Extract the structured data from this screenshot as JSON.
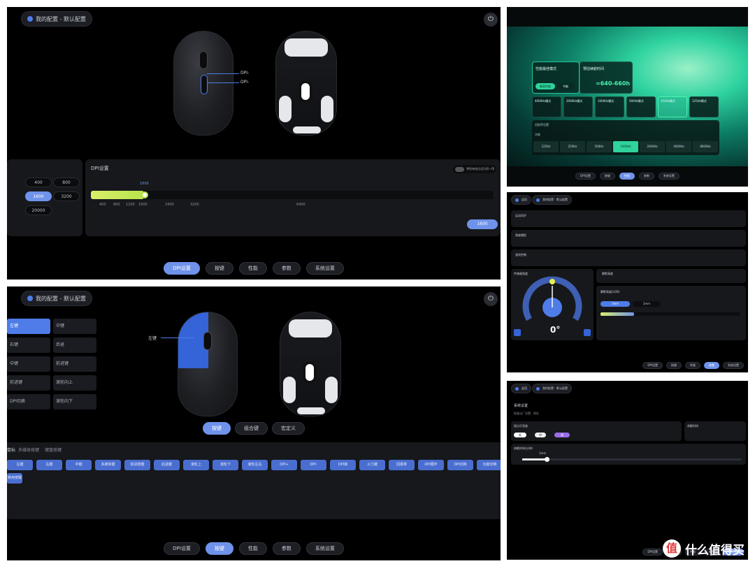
{
  "p1": {
    "config_label": "我的配置 - 默认配置",
    "callouts": [
      "DPI-",
      "DPI-"
    ],
    "dpi_panel_title": "DPI设置",
    "dpi_left_values": [
      "400",
      "800",
      "1600",
      "3200",
      "20000"
    ],
    "dpi_slider_value": "1600",
    "dpi_scale": [
      "400",
      "800",
      "1200",
      "1600",
      "2400",
      "3200",
      "6400"
    ],
    "toggle_label": "将所有档位设为同一DPI",
    "dpi_readout": "1600",
    "tabs": [
      "DPI设置",
      "按键",
      "性能",
      "参数",
      "系统设置"
    ],
    "active_tab": 0
  },
  "p2": {
    "config_label": "我的配置 - 默认配置",
    "callout": "左键",
    "side_buttons_left": [
      "左键",
      "右键",
      "中键",
      "前进键",
      "DPI切换"
    ],
    "side_buttons_right": [
      "中键",
      "后退",
      "前进键",
      "滚轮向上",
      "滚轮向下"
    ],
    "mode_buttons": [
      "按键",
      "组合键",
      "宏定义"
    ],
    "sub_tabs": [
      "鼠标",
      "多媒体按键",
      "键盘按键"
    ],
    "keys_row1": [
      "左键",
      "右键",
      "中键",
      "多媒体键",
      "前进按键",
      "后退键",
      "滚轮上",
      "滚轮下",
      "滚轮左右",
      "DPI+",
      "DPI-",
      "DPI锁",
      "火力键",
      "回报率",
      "DPI循环",
      "DPI切换",
      "功能切换"
    ],
    "keys_row2": [
      "禁用按键"
    ],
    "tabs": [
      "DPI设置",
      "按键",
      "性能",
      "参数",
      "系统设置"
    ],
    "active_tab": 1
  },
  "p3": {
    "card_title": "性能最佳模式",
    "card_btns": [
      "最高性能",
      "节能"
    ],
    "battery_title": "预估续航时间",
    "battery_value": "≈640-660h",
    "modes": [
      "4000Hz模式",
      "2000Hz模式",
      "1000Hz模式",
      "500Hz模式",
      "250Hz模式",
      "125Hz模式"
    ],
    "rate_label": "回报率设置",
    "rate_label2": "功耗",
    "rates": [
      "125Hz",
      "250Hz",
      "500Hz",
      "1000Hz",
      "2000Hz",
      "4000Hz",
      "8000Hz"
    ],
    "active_rate": 3,
    "tabs": [
      "DPI设置",
      "按键",
      "性能",
      "参数",
      "系统设置"
    ],
    "active_tab": 2
  },
  "p4": {
    "chips": [
      "返回",
      "我的配置 - 默认配置"
    ],
    "rows": [
      "运动同步",
      "角度捕捉",
      "波纹控制"
    ],
    "angle_title": "传感器角度",
    "angle_value": "0°",
    "ticks": [
      "-30°",
      "-20°",
      "-10°",
      "0°",
      "10°",
      "20°",
      "30°"
    ],
    "lod_title": "静默高度",
    "lod_label": "静默高度(LOD)",
    "lod_btns": [
      "1mm",
      "2mm"
    ],
    "tabs": [
      "DPI设置",
      "按键",
      "性能",
      "参数",
      "系统设置"
    ],
    "active_tab": 3
  },
  "p5": {
    "chips": [
      "返回",
      "我的配置 - 默认配置"
    ],
    "section": "系统设置",
    "sub": "恢复出厂设置 - 保存",
    "light_title": "指示灯亮度",
    "light_btns": [
      "低",
      "中",
      "高"
    ],
    "right_title": "休眠时间",
    "sleep_title": "休眠时间(分钟)",
    "sleep_value": "1min",
    "tabs": [
      "DPI设置",
      "按键",
      "性能",
      "参数",
      "系统设置"
    ],
    "active_tab": 4
  },
  "logo_text": "什么值得买",
  "logo_char": "值"
}
